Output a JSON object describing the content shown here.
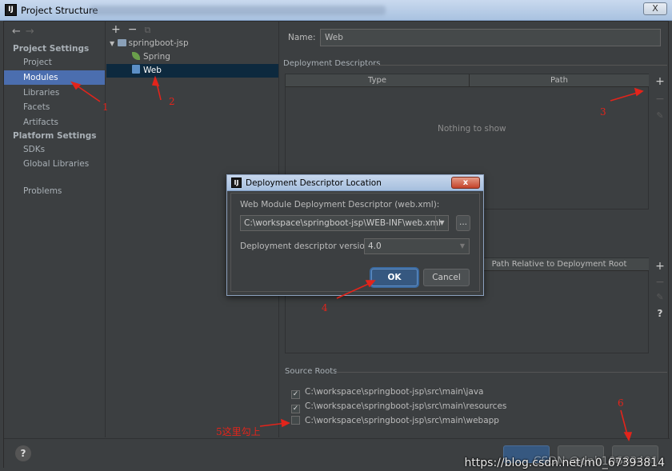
{
  "window": {
    "title": "Project Structure",
    "app_icon": "intellij-icon",
    "close_label": "X"
  },
  "nav": {
    "back": "←",
    "forward": "→"
  },
  "sidebar": {
    "project_settings_label": "Project Settings",
    "project_items": [
      {
        "label": "Project"
      },
      {
        "label": "Modules",
        "selected": true
      },
      {
        "label": "Libraries"
      },
      {
        "label": "Facets"
      },
      {
        "label": "Artifacts"
      }
    ],
    "platform_settings_label": "Platform Settings",
    "platform_items": [
      {
        "label": "SDKs"
      },
      {
        "label": "Global Libraries"
      }
    ],
    "problems_label": "Problems"
  },
  "tree": {
    "toolbar": {
      "add": "+",
      "remove": "−",
      "copy": "⧉"
    },
    "root": "springboot-jsp",
    "children": [
      "Spring",
      "Web"
    ],
    "selected": "Web"
  },
  "detail": {
    "name_label": "Name:",
    "name_value": "Web",
    "deployment_descriptors_title": "Deployment Descriptors",
    "dd_columns": [
      "Type",
      "Path"
    ],
    "dd_empty": "Nothing to show",
    "resource_column": "Path Relative to Deployment Root",
    "source_roots_title": "Source Roots",
    "source_roots": [
      {
        "path": "C:\\workspace\\springboot-jsp\\src\\main\\java",
        "checked": true
      },
      {
        "path": "C:\\workspace\\springboot-jsp\\src\\main\\resources",
        "checked": true
      },
      {
        "path": "C:\\workspace\\springboot-jsp\\src\\main\\webapp",
        "checked": false
      }
    ],
    "tools": {
      "add": "+",
      "remove": "−",
      "edit": "✎",
      "help": "?"
    }
  },
  "dialog": {
    "title": "Deployment Descriptor Location",
    "descriptor_label": "Web Module Deployment Descriptor (web.xml):",
    "descriptor_path": "C:\\workspace\\springboot-jsp\\WEB-INF\\web.xml",
    "browse_label": "...",
    "version_label": "Deployment descriptor version",
    "version_value": "4.0",
    "ok": "OK",
    "cancel": "Cancel",
    "close": "x"
  },
  "bottom": {
    "help": "?",
    "watermark": "https://blog.csdn.net/m0_67393814",
    "watermark_overlay": "CSDN @dnb10683401"
  },
  "annotations": {
    "n1": "1",
    "n2": "2",
    "n3": "3",
    "n4": "4",
    "n5": "5这里勾上",
    "n6": "6",
    "color": "#e3241b"
  },
  "colors": {
    "background": "#3c3f41",
    "selection": "#4b6eaf",
    "tree_selection": "#0d293e",
    "ok_button": "#365880"
  }
}
